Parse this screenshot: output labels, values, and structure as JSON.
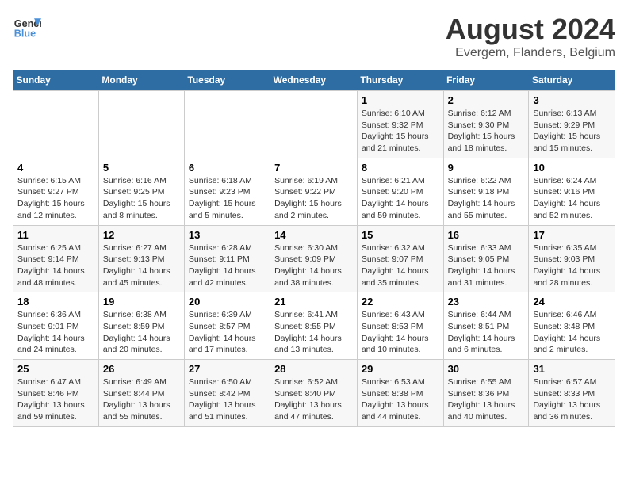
{
  "header": {
    "logo_line1": "General",
    "logo_line2": "Blue",
    "main_title": "August 2024",
    "subtitle": "Evergem, Flanders, Belgium"
  },
  "days_of_week": [
    "Sunday",
    "Monday",
    "Tuesday",
    "Wednesday",
    "Thursday",
    "Friday",
    "Saturday"
  ],
  "weeks": [
    [
      {
        "num": "",
        "info": ""
      },
      {
        "num": "",
        "info": ""
      },
      {
        "num": "",
        "info": ""
      },
      {
        "num": "",
        "info": ""
      },
      {
        "num": "1",
        "info": "Sunrise: 6:10 AM\nSunset: 9:32 PM\nDaylight: 15 hours\nand 21 minutes."
      },
      {
        "num": "2",
        "info": "Sunrise: 6:12 AM\nSunset: 9:30 PM\nDaylight: 15 hours\nand 18 minutes."
      },
      {
        "num": "3",
        "info": "Sunrise: 6:13 AM\nSunset: 9:29 PM\nDaylight: 15 hours\nand 15 minutes."
      }
    ],
    [
      {
        "num": "4",
        "info": "Sunrise: 6:15 AM\nSunset: 9:27 PM\nDaylight: 15 hours\nand 12 minutes."
      },
      {
        "num": "5",
        "info": "Sunrise: 6:16 AM\nSunset: 9:25 PM\nDaylight: 15 hours\nand 8 minutes."
      },
      {
        "num": "6",
        "info": "Sunrise: 6:18 AM\nSunset: 9:23 PM\nDaylight: 15 hours\nand 5 minutes."
      },
      {
        "num": "7",
        "info": "Sunrise: 6:19 AM\nSunset: 9:22 PM\nDaylight: 15 hours\nand 2 minutes."
      },
      {
        "num": "8",
        "info": "Sunrise: 6:21 AM\nSunset: 9:20 PM\nDaylight: 14 hours\nand 59 minutes."
      },
      {
        "num": "9",
        "info": "Sunrise: 6:22 AM\nSunset: 9:18 PM\nDaylight: 14 hours\nand 55 minutes."
      },
      {
        "num": "10",
        "info": "Sunrise: 6:24 AM\nSunset: 9:16 PM\nDaylight: 14 hours\nand 52 minutes."
      }
    ],
    [
      {
        "num": "11",
        "info": "Sunrise: 6:25 AM\nSunset: 9:14 PM\nDaylight: 14 hours\nand 48 minutes."
      },
      {
        "num": "12",
        "info": "Sunrise: 6:27 AM\nSunset: 9:13 PM\nDaylight: 14 hours\nand 45 minutes."
      },
      {
        "num": "13",
        "info": "Sunrise: 6:28 AM\nSunset: 9:11 PM\nDaylight: 14 hours\nand 42 minutes."
      },
      {
        "num": "14",
        "info": "Sunrise: 6:30 AM\nSunset: 9:09 PM\nDaylight: 14 hours\nand 38 minutes."
      },
      {
        "num": "15",
        "info": "Sunrise: 6:32 AM\nSunset: 9:07 PM\nDaylight: 14 hours\nand 35 minutes."
      },
      {
        "num": "16",
        "info": "Sunrise: 6:33 AM\nSunset: 9:05 PM\nDaylight: 14 hours\nand 31 minutes."
      },
      {
        "num": "17",
        "info": "Sunrise: 6:35 AM\nSunset: 9:03 PM\nDaylight: 14 hours\nand 28 minutes."
      }
    ],
    [
      {
        "num": "18",
        "info": "Sunrise: 6:36 AM\nSunset: 9:01 PM\nDaylight: 14 hours\nand 24 minutes."
      },
      {
        "num": "19",
        "info": "Sunrise: 6:38 AM\nSunset: 8:59 PM\nDaylight: 14 hours\nand 20 minutes."
      },
      {
        "num": "20",
        "info": "Sunrise: 6:39 AM\nSunset: 8:57 PM\nDaylight: 14 hours\nand 17 minutes."
      },
      {
        "num": "21",
        "info": "Sunrise: 6:41 AM\nSunset: 8:55 PM\nDaylight: 14 hours\nand 13 minutes."
      },
      {
        "num": "22",
        "info": "Sunrise: 6:43 AM\nSunset: 8:53 PM\nDaylight: 14 hours\nand 10 minutes."
      },
      {
        "num": "23",
        "info": "Sunrise: 6:44 AM\nSunset: 8:51 PM\nDaylight: 14 hours\nand 6 minutes."
      },
      {
        "num": "24",
        "info": "Sunrise: 6:46 AM\nSunset: 8:48 PM\nDaylight: 14 hours\nand 2 minutes."
      }
    ],
    [
      {
        "num": "25",
        "info": "Sunrise: 6:47 AM\nSunset: 8:46 PM\nDaylight: 13 hours\nand 59 minutes."
      },
      {
        "num": "26",
        "info": "Sunrise: 6:49 AM\nSunset: 8:44 PM\nDaylight: 13 hours\nand 55 minutes."
      },
      {
        "num": "27",
        "info": "Sunrise: 6:50 AM\nSunset: 8:42 PM\nDaylight: 13 hours\nand 51 minutes."
      },
      {
        "num": "28",
        "info": "Sunrise: 6:52 AM\nSunset: 8:40 PM\nDaylight: 13 hours\nand 47 minutes."
      },
      {
        "num": "29",
        "info": "Sunrise: 6:53 AM\nSunset: 8:38 PM\nDaylight: 13 hours\nand 44 minutes."
      },
      {
        "num": "30",
        "info": "Sunrise: 6:55 AM\nSunset: 8:36 PM\nDaylight: 13 hours\nand 40 minutes."
      },
      {
        "num": "31",
        "info": "Sunrise: 6:57 AM\nSunset: 8:33 PM\nDaylight: 13 hours\nand 36 minutes."
      }
    ]
  ]
}
